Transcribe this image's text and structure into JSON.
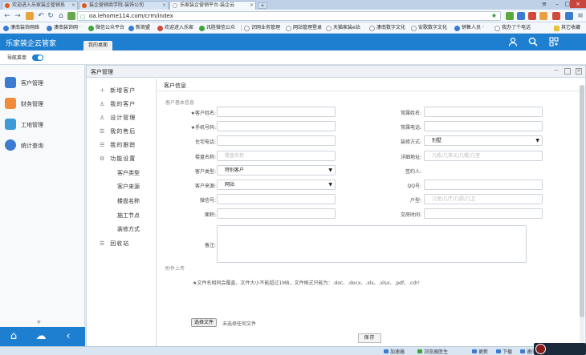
{
  "browser": {
    "tabs": [
      {
        "label": "欢迎进入乐家装企管销系",
        "active": false
      },
      {
        "label": "装企营销商学院-装饰公司",
        "active": false
      },
      {
        "label": "乐家装企营销平台-装企云",
        "active": true
      }
    ],
    "url": "oa.lehome114.com/crm/index",
    "bookmarks": [
      "凄南装饰网络",
      "凄南装饰网 ·",
      "微信公众平台",
      "新商盟",
      "欢迎进入乐家",
      "讯胜微信公众",
      "识网业务管理",
      "网站管理登录",
      "天猫家装e站",
      "凄南数字文化",
      "安歌数字文化",
      "销售人员 ·",
      "我办了个电话",
      "其它收藏"
    ],
    "status_items": [
      "加速器",
      "浏览器医生",
      "更新",
      "下载",
      "速问"
    ]
  },
  "app": {
    "logo": "乐家装企云管家",
    "desk_tab": "我的桌面",
    "nav_toggle_label": "导航菜单"
  },
  "sidebar": {
    "items": [
      {
        "label": "客户管理",
        "icon": "user-icon",
        "color": "#3b7bd0"
      },
      {
        "label": "财务管理",
        "icon": "person-icon",
        "color": "#f08c3a"
      },
      {
        "label": "工地管理",
        "icon": "building-icon",
        "color": "#3b9ad8"
      },
      {
        "label": "统计查询",
        "icon": "chart-icon",
        "color": "#3b7bd0"
      }
    ]
  },
  "window": {
    "title": "客户管理",
    "menu": [
      {
        "label": "新增客户",
        "icon": "plus-icon",
        "sub": false
      },
      {
        "label": "我的客户",
        "icon": "person-outline-icon",
        "sub": false
      },
      {
        "label": "设计管理",
        "icon": "person-outline-icon",
        "sub": false
      },
      {
        "label": "我的售后",
        "icon": "list-icon",
        "sub": false
      },
      {
        "label": "我的跟踪",
        "icon": "list-icon",
        "sub": false
      },
      {
        "label": "功能设置",
        "icon": "gear-icon",
        "sub": false
      },
      {
        "label": "客户类型",
        "icon": "",
        "sub": true
      },
      {
        "label": "客户来源",
        "icon": "",
        "sub": true
      },
      {
        "label": "楼盘名称",
        "icon": "",
        "sub": true
      },
      {
        "label": "施工节点",
        "icon": "",
        "sub": true
      },
      {
        "label": "装修方式",
        "icon": "",
        "sub": true
      },
      {
        "label": "回收站",
        "icon": "list-icon",
        "sub": false
      }
    ]
  },
  "form": {
    "title": "客户信息",
    "section_basic": "客户基本信息",
    "section_attach": "附件上传",
    "left_fields": [
      {
        "label": "★客户姓名:",
        "type": "input",
        "value": "",
        "placeholder": ""
      },
      {
        "label": "★手机号码:",
        "type": "input",
        "value": "",
        "placeholder": ""
      },
      {
        "label": "住宅电话:",
        "type": "input",
        "value": "",
        "placeholder": ""
      },
      {
        "label": "楼盘名称:",
        "type": "input",
        "value": "",
        "placeholder": "楼盘名称"
      },
      {
        "label": "客户类型:",
        "type": "select",
        "value": "特别客户",
        "placeholder": ""
      },
      {
        "label": "客户来源:",
        "type": "select",
        "value": "网站",
        "placeholder": ""
      },
      {
        "label": "微信号:",
        "type": "input",
        "value": "",
        "placeholder": ""
      },
      {
        "label": "面积:",
        "type": "input",
        "value": "",
        "placeholder": ""
      }
    ],
    "right_fields": [
      {
        "label": "常属姓名:",
        "type": "input",
        "value": "",
        "placeholder": ""
      },
      {
        "label": "常属电话:",
        "type": "input",
        "value": "",
        "placeholder": ""
      },
      {
        "label": "装修方式:",
        "type": "select",
        "value": "别墅",
        "placeholder": ""
      },
      {
        "label": "详细地址:",
        "type": "input",
        "value": "",
        "placeholder": "几栋/几单元/几楼/几室"
      },
      {
        "label": "签约人:",
        "type": "none",
        "value": "",
        "placeholder": ""
      },
      {
        "label": "QQ号:",
        "type": "input",
        "value": "",
        "placeholder": ""
      },
      {
        "label": "户型:",
        "type": "input",
        "value": "",
        "placeholder": "几室/几厅/几厨/几卫"
      },
      {
        "label": "交房时间:",
        "type": "input",
        "value": "",
        "placeholder": ""
      }
    ],
    "remark_label": "备注:",
    "upload_note": "★文件名相同会覆盖，文件大小不能超过1MB，文件格式只能为：.doc、.docx、.xls、.xlsx、.pdf、.cdr!",
    "file_button": "选择文件",
    "file_status": "未选择任何文件",
    "save_button": "保存"
  }
}
